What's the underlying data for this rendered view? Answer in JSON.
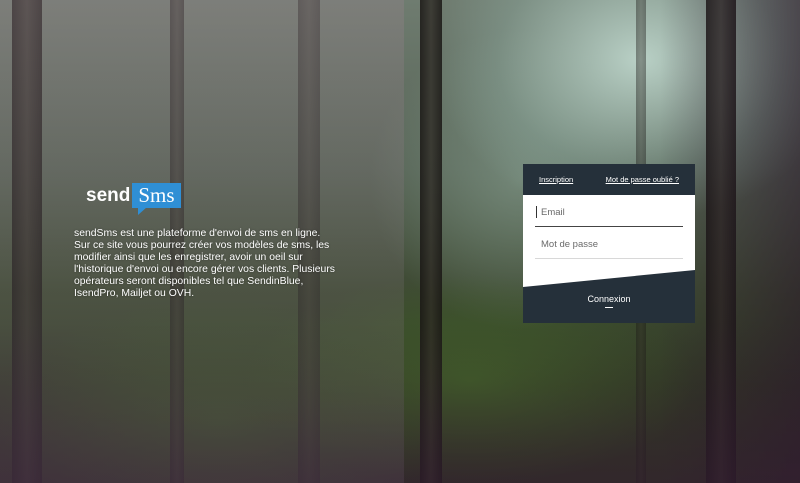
{
  "brand": {
    "prefix": "send",
    "badge": "Sms"
  },
  "description": "sendSms est une plateforme d'envoi de sms en ligne. Sur ce site vous pourrez créer vos modèles de sms, les modifier ainsi que les enregistrer, avoir un oeil sur l'historique d'envoi ou encore gérer vos clients. Plusieurs opérateurs seront disponibles tel que SendinBlue, IsendPro, Mailjet ou OVH.",
  "login": {
    "signup_link": "Inscription",
    "forgot_link": "Mot de passe oublié ?",
    "email_placeholder": "Email",
    "password_placeholder": "Mot de passe",
    "submit_label": "Connexion"
  },
  "colors": {
    "brand_blue": "#2f8fd5",
    "card_dark": "#25303a"
  }
}
